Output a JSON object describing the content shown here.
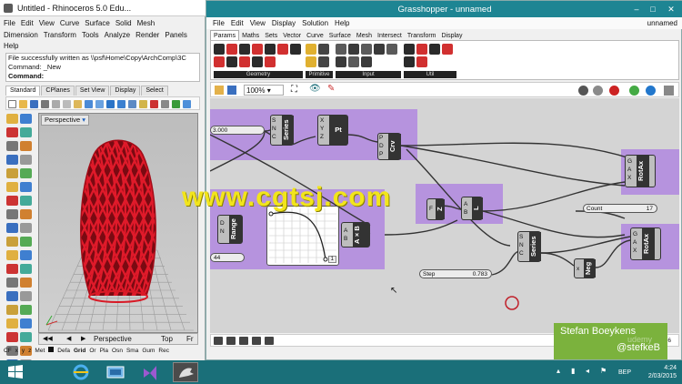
{
  "rhino": {
    "title": "Untitled - Rhinoceros 5.0 Edu...",
    "menu_row1": [
      "File",
      "Edit",
      "View",
      "Curve",
      "Surface",
      "Solid",
      "Mesh"
    ],
    "menu_row2": [
      "Dimension",
      "Transform",
      "Tools",
      "Analyze",
      "Render",
      "Panels"
    ],
    "menu_row3": [
      "Help"
    ],
    "command_history": [
      "File successfully written as \\\\psf\\Home\\Copy\\ArchComp\\3C",
      "Command: _New"
    ],
    "command_prompt": "Command:",
    "toolbar_tabs": [
      "Standard",
      "CPlanes",
      "Set View",
      "Display",
      "Select"
    ],
    "viewport_label": "Perspective",
    "viewport_tabs": [
      "Perspective",
      "Top",
      "Fr"
    ],
    "status_items": [
      "CF",
      "x",
      "y",
      "z",
      "Met",
      "Defa",
      "Grid",
      "Or",
      "Pla",
      "Osn",
      "Sma",
      "Gum",
      "Rec"
    ]
  },
  "grasshopper": {
    "title": "Grasshopper - unnamed",
    "document_name": "unnamed",
    "menu": [
      "File",
      "Edit",
      "View",
      "Display",
      "Solution",
      "Help"
    ],
    "category_tabs": [
      "Params",
      "Maths",
      "Sets",
      "Vector",
      "Curve",
      "Surface",
      "Mesh",
      "Intersect",
      "Transform",
      "Display"
    ],
    "active_tab": "Params",
    "ribbon_groups": [
      "Geometry",
      "Primitive",
      "Input",
      "Util"
    ],
    "zoom": "100%",
    "components": [
      {
        "name": "Series",
        "ports_in": [
          "S",
          "N",
          "C"
        ]
      },
      {
        "name": "Pt",
        "ports_in": [
          "X",
          "Y",
          "Z"
        ]
      },
      {
        "name": "Crv",
        "ports_in": [
          "P",
          "D",
          "P"
        ]
      },
      {
        "name": "Range",
        "ports_in": [
          "D",
          "N"
        ]
      },
      {
        "name": "A×B",
        "ports_in": [
          "A",
          "B"
        ]
      },
      {
        "name": "Z",
        "ports_in": [
          "F"
        ]
      },
      {
        "name": "L",
        "ports_in": [
          "A",
          "B"
        ]
      },
      {
        "name": "Series",
        "ports_in": [
          "S",
          "N",
          "C"
        ]
      },
      {
        "name": "Neg",
        "ports_in": [
          "x"
        ]
      },
      {
        "name": "RotAx",
        "ports_in": [
          "G",
          "A",
          "X"
        ]
      },
      {
        "name": "RotAx",
        "ports_in": [
          "G",
          "A",
          "X"
        ]
      }
    ],
    "sliders": [
      {
        "name": "",
        "value": "3.000"
      },
      {
        "name": "Step",
        "value": "0.783"
      },
      {
        "name": "Count",
        "value": "17"
      }
    ],
    "graph_box_number": "44",
    "graph_box_output": "1",
    "status_value": "0.9.0076"
  },
  "overlay": {
    "watermark": "www.cgtsj.com",
    "presenter_name": "Stefan Boeykens",
    "presenter_handle": "@stefkeB",
    "brand": "udemy"
  },
  "taskbar": {
    "lang": "BEP",
    "time": "4:24",
    "date": "2/03/2015"
  },
  "colors": {
    "gh_title": "#1e8593",
    "group_purple": "#b48fde",
    "rhino_mesh_red": "#cc1020",
    "presenter_green": "#7bb23d",
    "taskbar": "#1a6f79"
  }
}
